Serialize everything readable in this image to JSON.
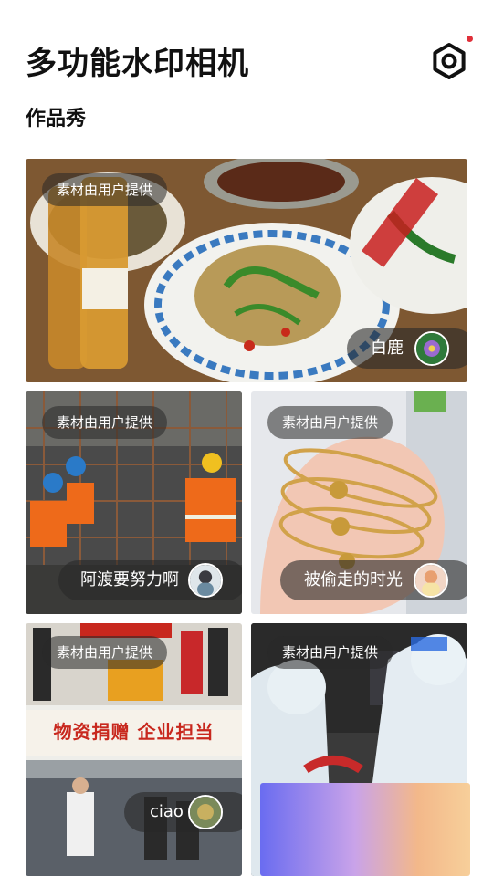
{
  "header": {
    "app_title": "多功能水印相机",
    "settings_icon": "settings-gear-icon",
    "notification_color": "#e0303a"
  },
  "section": {
    "title": "作品秀"
  },
  "cards": [
    {
      "tag": "素材由用户提供",
      "author": "白鹿",
      "image": "food-dinner-photo"
    },
    {
      "tag": "素材由用户提供",
      "author": "阿渡要努力啊",
      "image": "construction-workers-photo"
    },
    {
      "tag": "素材由用户提供",
      "author": "被偷走的时光",
      "image": "gold-bracelets-photo"
    },
    {
      "tag": "素材由用户提供",
      "author": "ciao",
      "image": "donation-event-photo"
    },
    {
      "tag": "素材由用户提供",
      "author": "",
      "image": "medical-workers-photo"
    }
  ],
  "photo_text": {
    "poster_headline": "物资捐赠 企业担当"
  }
}
